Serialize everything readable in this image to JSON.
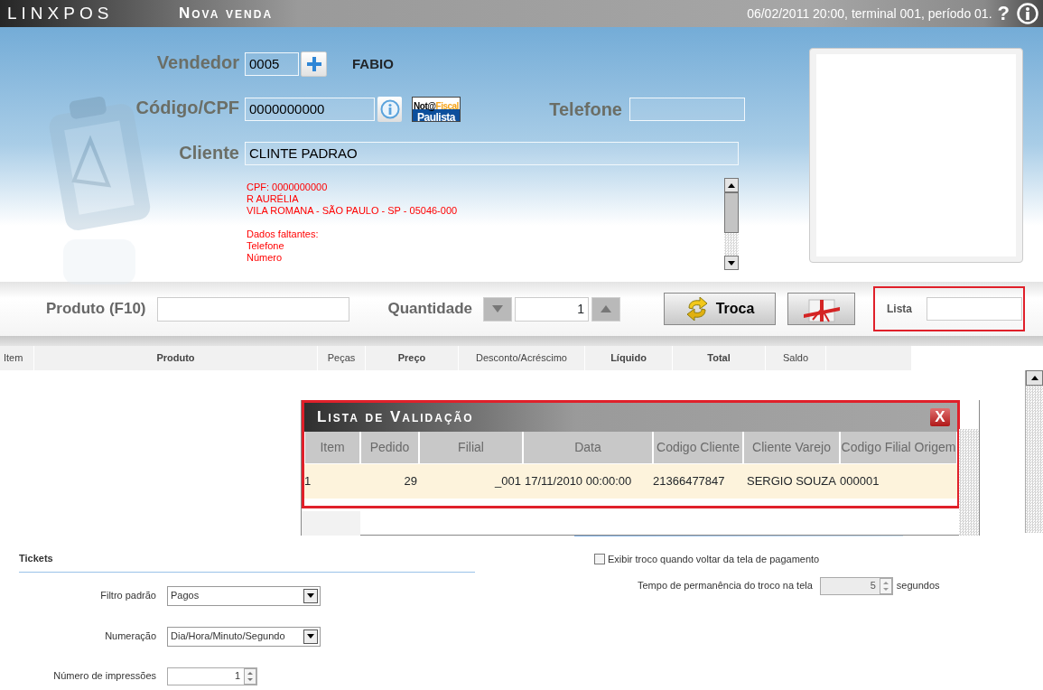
{
  "titlebar": {
    "logo": "LINXPOS",
    "title": "Nova venda",
    "status": "06/02/2011 20:00, terminal 001, período 01.",
    "help": "?"
  },
  "vendedor": {
    "label": "Vendedor",
    "value": "0005",
    "name": "FABIO"
  },
  "codigo": {
    "label": "Código/CPF",
    "value": "0000000000"
  },
  "nfp_logo": {
    "part1": "Not@",
    "part2": "Fiscal",
    "part3": "Paulista"
  },
  "telefone": {
    "label": "Telefone"
  },
  "cliente": {
    "label": "Cliente",
    "value": "CLINTE PADRAO"
  },
  "client_info": {
    "blocks": [
      [
        "CPF: 0000000000",
        "R AURÉLIA",
        "VILA ROMANA - SÃO PAULO - SP - 05046-000"
      ],
      [
        "Dados faltantes:",
        "Telefone",
        "Número"
      ]
    ]
  },
  "product_bar": {
    "produto_label": "Produto (F10)",
    "quantidade_label": "Quantidade",
    "quantidade": "1",
    "troca": "Troca",
    "lista_label": "Lista",
    "lista_highlighted": true
  },
  "table": {
    "columns": [
      {
        "label": "Item",
        "bold": false
      },
      {
        "label": "Produto",
        "bold": true
      },
      {
        "label": "Peças",
        "bold": false
      },
      {
        "label": "Preço",
        "bold": true
      },
      {
        "label": "Desconto/Acréscimo",
        "bold": false
      },
      {
        "label": "Líquido",
        "bold": true
      },
      {
        "label": "Total",
        "bold": true
      },
      {
        "label": "Saldo",
        "bold": false
      }
    ]
  },
  "popup": {
    "title": "Lista de Validação",
    "close": "X",
    "highlighted": true,
    "columns": [
      "Item",
      "Pedido",
      "Filial",
      "Data",
      "Codigo Cliente",
      "Cliente Varejo",
      "Codigo Filial Origem"
    ],
    "rows": [
      {
        "cells": [
          "1",
          "29",
          "_001",
          "17/11/2010 00:00:00",
          "21366477847",
          "SERGIO SOUZA",
          "000001"
        ],
        "selected": true
      }
    ]
  },
  "settings": {
    "heading": "Tickets",
    "rows": [
      {
        "kind": "select",
        "label": "Filtro padrão",
        "value": "Pagos"
      },
      {
        "kind": "select",
        "label": "Numeração",
        "value": "Dia/Hora/Minuto/Segundo"
      },
      {
        "kind": "spinner",
        "label": "Número de impressões",
        "value": "1"
      }
    ],
    "checkbox": {
      "label": "Exibir troco quando voltar da tela de pagamento",
      "checked": false
    },
    "troco": {
      "label": "Tempo de permanência do troco na tela",
      "value": "5",
      "unit": "segundos",
      "disabled": true
    }
  }
}
